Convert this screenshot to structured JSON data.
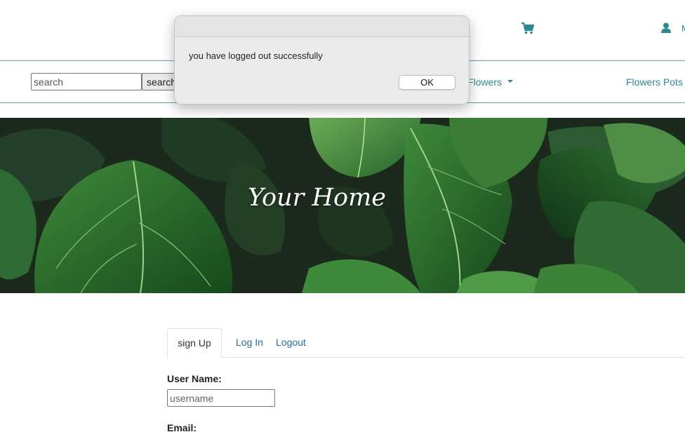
{
  "header": {
    "cart_icon": "shopping-cart-icon",
    "user_icon": "user-icon",
    "user_label": "M",
    "accent_color": "#2a8a92"
  },
  "nav": {
    "search_placeholder": "search",
    "search_button_label": "search",
    "flowers_label": "Flowers",
    "pots_label": "Flowers Pots"
  },
  "hero": {
    "title": "Your Home"
  },
  "tabs": [
    {
      "label": "sign Up",
      "active": true
    },
    {
      "label": "Log In",
      "active": false
    },
    {
      "label": "Logout",
      "active": false
    }
  ],
  "form": {
    "username_label": "User Name:",
    "username_placeholder": "username",
    "email_label": "Email:"
  },
  "dialog": {
    "message": "you have logged out successfully",
    "ok_label": "OK"
  }
}
